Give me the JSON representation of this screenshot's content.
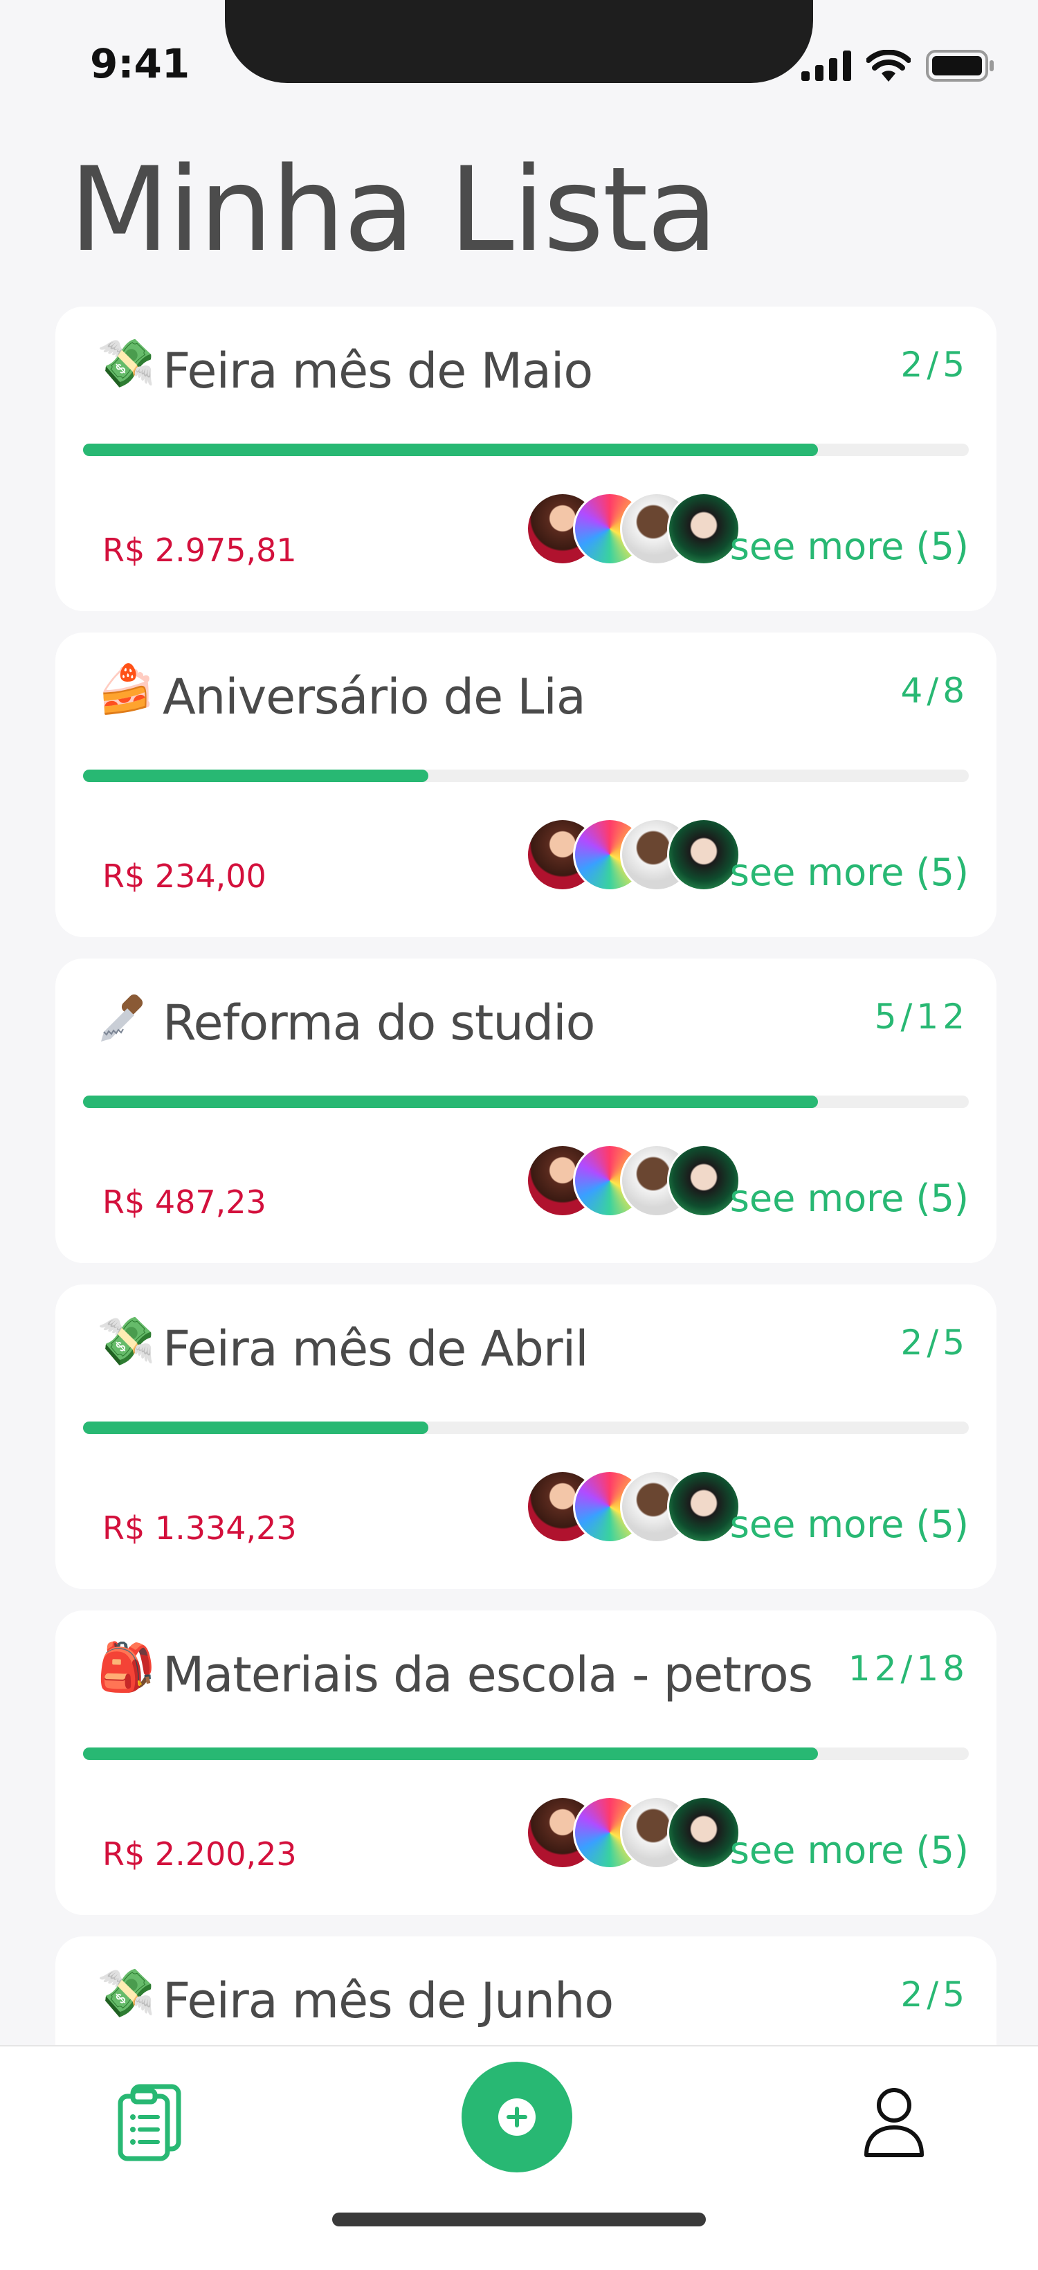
{
  "status_bar": {
    "time": "9:41"
  },
  "page": {
    "title": "Minha Lista"
  },
  "lists": [
    {
      "emoji": "💸",
      "icon": "money-with-wings-icon",
      "title": "Feira mês de Maio",
      "count": "2/5",
      "progress": 0.83,
      "price": "R$ 2.975,81",
      "see_more": "see more (5)"
    },
    {
      "emoji": "🍰",
      "icon": "cake-icon",
      "title": "Aniversário de Lia",
      "count": "4/8",
      "progress": 0.39,
      "price": "R$ 234,00",
      "see_more": "see more (5)"
    },
    {
      "emoji": "🪚",
      "icon": "saw-icon",
      "title": "Reforma do studio",
      "count": "5/12",
      "progress": 0.83,
      "price": "R$ 487,23",
      "see_more": "see more (5)"
    },
    {
      "emoji": "💸",
      "icon": "money-with-wings-icon",
      "title": "Feira mês de Abril",
      "count": "2/5",
      "progress": 0.39,
      "price": "R$ 1.334,23",
      "see_more": "see more (5)"
    },
    {
      "emoji": "🎒",
      "icon": "backpack-icon",
      "title": "Materiais da escola - petros",
      "count": "12/18",
      "progress": 0.83,
      "price": "R$ 2.200,23",
      "see_more": "see more (5)"
    },
    {
      "emoji": "💸",
      "icon": "money-with-wings-icon",
      "title": "Feira mês de Junho",
      "count": "2/5",
      "progress": null,
      "price": "",
      "see_more": ""
    }
  ],
  "tab_bar": {
    "items": [
      {
        "name": "lists",
        "icon": "clipboard-list-icon"
      },
      {
        "name": "add",
        "icon": "plus-icon"
      },
      {
        "name": "profile",
        "icon": "person-icon"
      }
    ]
  },
  "colors": {
    "accent": "#28b873",
    "price": "#d3103c",
    "title": "#4c4c4c",
    "background": "#f6f6f8"
  }
}
